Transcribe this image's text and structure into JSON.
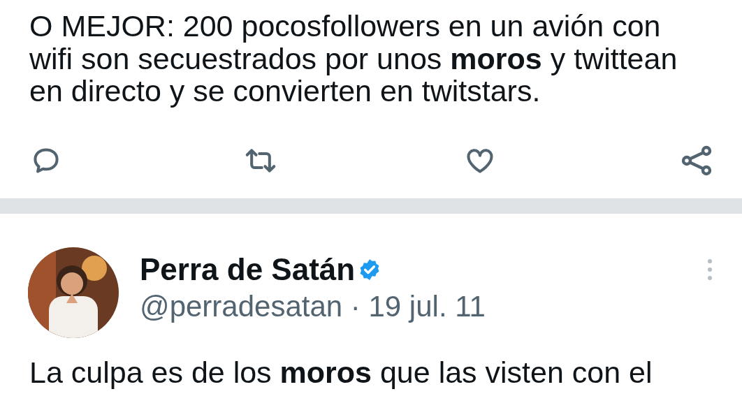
{
  "tweets": [
    {
      "lines": [
        "O MEJOR: 200 pocosfollowers en un avión con",
        "wifi son secuestrados por unos **moros** y twittean",
        "en directo y se convierten en twitstars."
      ]
    },
    {
      "author": "Perra de Satán",
      "verified": true,
      "meta": "@perradesatan · 19 jul. 11",
      "lines": [
        "La culpa es de los **moros** que las visten con el"
      ]
    }
  ]
}
